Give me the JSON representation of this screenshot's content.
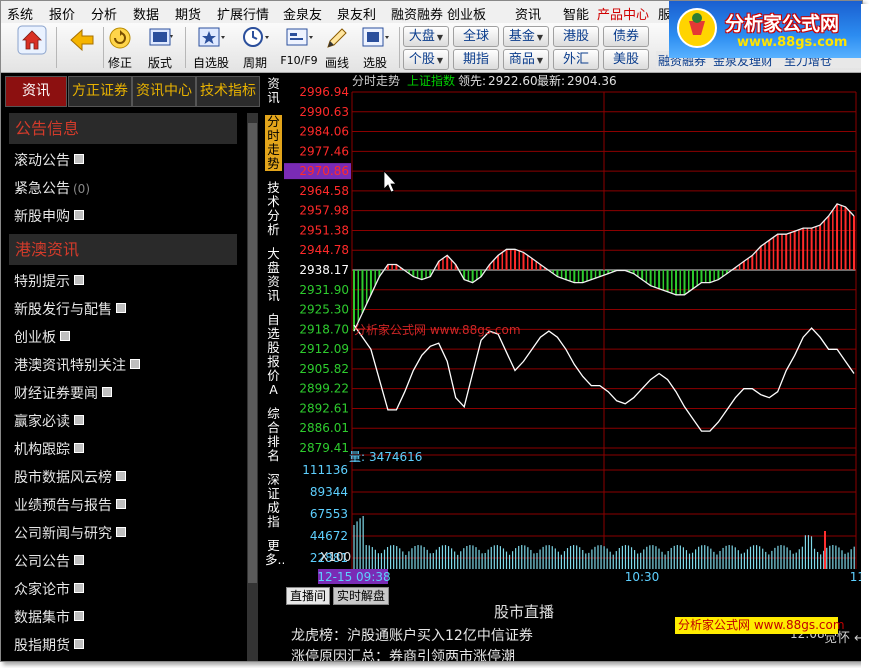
{
  "menu": [
    "系统",
    "报价",
    "分析",
    "数据",
    "期货",
    "扩展行情",
    "金泉友",
    "泉友利",
    "融资融券",
    "创业板",
    "资讯",
    "智能",
    "产品中心",
    "服"
  ],
  "menu_highlight_index": 12,
  "toolbar": {
    "buttons": [
      {
        "label": "",
        "icon": "home-icon"
      },
      {
        "label": "",
        "icon": "back-arrow-icon"
      },
      {
        "label": "修正",
        "icon": "refresh-icon"
      },
      {
        "label": "版式",
        "icon": "layout-icon"
      },
      {
        "label": "自选股",
        "icon": "star-icon"
      },
      {
        "label": "周期",
        "icon": "clock-icon"
      },
      {
        "label": "F10/F9",
        "icon": "f10-icon"
      },
      {
        "label": "画线",
        "icon": "pen-icon"
      },
      {
        "label": "选股",
        "icon": "select-stock-icon"
      }
    ],
    "market_buttons": [
      [
        "大盘",
        "全球",
        "基金",
        "港股",
        "债券"
      ],
      [
        "个股",
        "期指",
        "商品",
        "外汇",
        "美股"
      ]
    ],
    "market_has_dropdown": [
      [
        true,
        false,
        true,
        false,
        false
      ],
      [
        true,
        false,
        true,
        false,
        false
      ]
    ]
  },
  "logo": {
    "name": "分析家公式网",
    "url": "www.88gs.com"
  },
  "top_strip": [
    "融资融券",
    "金泉友理财",
    "至刀增仓"
  ],
  "left_panel": {
    "tabs": [
      "资讯",
      "方正证券",
      "资讯中心",
      "技术指标"
    ],
    "active_tab": 0,
    "sections": [
      {
        "title": "公告信息",
        "items": [
          {
            "label": "滚动公告",
            "count": ""
          },
          {
            "label": "紧急公告",
            "count": "(0)"
          },
          {
            "label": "新股申购",
            "count": ""
          }
        ]
      },
      {
        "title": "港澳资讯",
        "items": [
          {
            "label": "特别提示",
            "count": ""
          },
          {
            "label": "新股发行与配售",
            "count": ""
          },
          {
            "label": "创业板",
            "count": ""
          },
          {
            "label": "港澳资讯特别关注",
            "count": ""
          },
          {
            "label": "财经证券要闻",
            "count": ""
          },
          {
            "label": "赢家必读",
            "count": ""
          },
          {
            "label": "机构跟踪",
            "count": ""
          },
          {
            "label": "股市数据风云榜",
            "count": ""
          },
          {
            "label": "业绩预告与报告",
            "count": ""
          },
          {
            "label": "公司新闻与研究",
            "count": ""
          },
          {
            "label": "公司公告",
            "count": ""
          },
          {
            "label": "众家论市",
            "count": ""
          },
          {
            "label": "数据集市",
            "count": ""
          },
          {
            "label": "股指期货",
            "count": ""
          }
        ]
      }
    ]
  },
  "vertical_tabs": [
    "资讯",
    "分时走势",
    "技术分析",
    "大盘资讯",
    "自选股报价A",
    "综合排名",
    "深证成指",
    "更多.."
  ],
  "vertical_active": 1,
  "chart_header": {
    "mode": "分时走势",
    "index_name": "上证指数",
    "lead_label": "领先:",
    "lead_value": "2922.60",
    "latest_label": "最新:",
    "latest_value": "2904.36"
  },
  "chart_data": {
    "type": "line",
    "title": "上证指数 分时走势",
    "prev_close": 2938.17,
    "ylim": [
      2879.41,
      2996.94
    ],
    "price_ticks": [
      "2996.94",
      "2990.63",
      "2984.06",
      "2977.46",
      "2970.86",
      "2964.58",
      "2957.98",
      "2951.38",
      "2944.78",
      "2938.17",
      "2931.90",
      "2925.30",
      "2918.70",
      "2912.09",
      "2905.82",
      "2899.22",
      "2892.61",
      "2886.01",
      "2879.41"
    ],
    "highlight_tick": "2970.86",
    "x_ticks": [
      "12-15 09:38",
      "10:30",
      "11:30"
    ],
    "price_series": [
      {
        "name": "最新",
        "values": [
          2920,
          2916,
          2912,
          2902,
          2892,
          2892,
          2898,
          2905,
          2910,
          2913,
          2914,
          2908,
          2896,
          2893,
          2904,
          2915,
          2918,
          2917,
          2911,
          2905,
          2908,
          2912,
          2916,
          2918,
          2916,
          2912,
          2907,
          2903,
          2900,
          2900,
          2898,
          2895,
          2894,
          2896,
          2899,
          2902,
          2904,
          2902,
          2898,
          2893,
          2889,
          2885,
          2885,
          2888,
          2892,
          2896,
          2899,
          2899,
          2897,
          2896,
          2898,
          2905,
          2910,
          2916,
          2919,
          2916,
          2912,
          2912,
          2908,
          2904
        ]
      },
      {
        "name": "领先",
        "values": [
          2918,
          2924,
          2930,
          2936,
          2940,
          2940,
          2938,
          2936,
          2935,
          2936,
          2941,
          2943,
          2940,
          2935,
          2934,
          2936,
          2940,
          2943,
          2945,
          2945,
          2944,
          2942,
          2940,
          2938,
          2936,
          2935,
          2934,
          2934,
          2935,
          2936,
          2937,
          2938,
          2938,
          2937,
          2935,
          2933,
          2932,
          2931,
          2930,
          2930,
          2932,
          2934,
          2934,
          2935,
          2937,
          2939,
          2941,
          2943,
          2946,
          2948,
          2950,
          2950,
          2951,
          2952,
          2952,
          2953,
          2956,
          2960,
          2959,
          2956
        ]
      }
    ],
    "volume_label": "量:",
    "volume_value": "3474616",
    "volume_ticks": [
      "111136",
      "89344",
      "67553",
      "44672",
      "22881"
    ],
    "volume_multiplier": "X100"
  },
  "news": {
    "tabs": [
      "直播间",
      "实时解盘"
    ],
    "active_tab": 0,
    "title": "股市直播",
    "lines": [
      "龙虎榜：沪股通账户买入12亿中信证券",
      "涨停原因汇总：券商引领两市涨停潮"
    ],
    "watermark": "分析家公式网 www.88gs.com",
    "time": "12:08",
    "more": "觉怀 ↔"
  },
  "colors": {
    "up": "#ff2a2a",
    "down": "#2ecc2e",
    "grid": "#8b0000",
    "volume": "#7fd8e8",
    "accent": "#e3a51b"
  }
}
